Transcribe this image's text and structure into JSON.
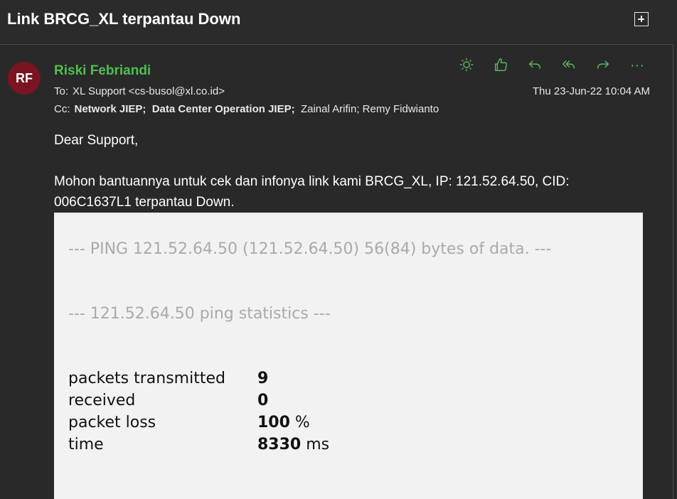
{
  "header": {
    "subject": "Link BRCG_XL terpantau Down",
    "expand_icon": "popout-icon"
  },
  "message": {
    "avatar_initials": "RF",
    "sender": "Riski Febriandi",
    "to_label": "To:",
    "to_value": "XL Support <cs-busol@xl.co.id>",
    "cc_label": "Cc:",
    "cc_bold_1": "Network JIEP;",
    "cc_bold_2": "Data Center Operation JIEP;",
    "cc_rest": "Zainal Arifin;  Remy Fidwianto",
    "date": "Thu 23-Jun-22 10:04 AM",
    "actions": [
      "sun-icon",
      "like-icon",
      "reply-icon",
      "reply-all-icon",
      "forward-icon",
      "more-icon"
    ],
    "more_glyph": "···",
    "greeting": "Dear Support,",
    "line1": "Mohon bantuannya untuk cek dan infonya link kami BRCG_XL, IP: 121.52.64.50, CID:",
    "line2": "006C1637L1 terpantau Down."
  },
  "ping": {
    "header_line": "--- PING 121.52.64.50 (121.52.64.50) 56(84) bytes of data. ---",
    "stats_line": "--- 121.52.64.50 ping statistics ---",
    "rows": [
      {
        "key": "packets transmitted",
        "value": "9",
        "unit": ""
      },
      {
        "key": "received",
        "value": "0",
        "unit": ""
      },
      {
        "key": "packet loss",
        "value": "100",
        "unit": " %"
      },
      {
        "key": "time",
        "value": "8330",
        "unit": " ms"
      }
    ]
  },
  "colors": {
    "accent_green": "#58b85a",
    "avatar_bg": "#7a1421",
    "background": "#292929"
  }
}
